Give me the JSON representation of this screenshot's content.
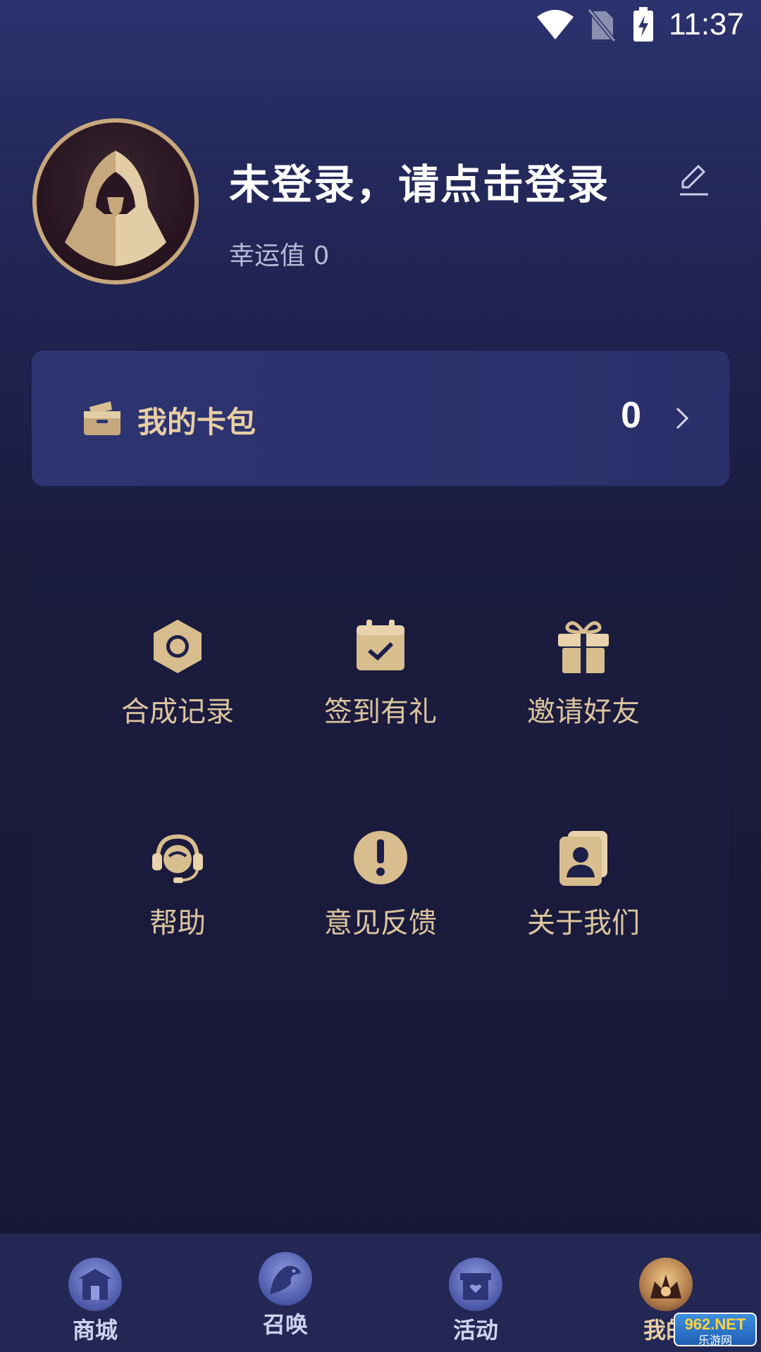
{
  "status_bar": {
    "time": "11:37",
    "icons": [
      "wifi-icon",
      "no-sim-icon",
      "battery-charging-icon"
    ]
  },
  "profile": {
    "title": "未登录，请点击登录",
    "luck_label": "幸运值",
    "luck_value": "0",
    "avatar_icon": "hooded-figure-avatar",
    "edit_icon": "edit-pencil-icon"
  },
  "wallet": {
    "label": "我的卡包",
    "count": "0",
    "icon": "card-wallet-icon",
    "chevron": "chevron-right-icon"
  },
  "menu": {
    "items": [
      {
        "label": "合成记录",
        "icon": "hexagon-target-icon"
      },
      {
        "label": "签到有礼",
        "icon": "calendar-check-icon"
      },
      {
        "label": "邀请好友",
        "icon": "gift-icon"
      },
      {
        "label": "帮助",
        "icon": "headset-icon"
      },
      {
        "label": "意见反馈",
        "icon": "exclamation-icon"
      },
      {
        "label": "关于我们",
        "icon": "contact-card-icon"
      }
    ]
  },
  "bottom_nav": {
    "items": [
      {
        "label": "商城",
        "icon": "shop-icon",
        "active": false
      },
      {
        "label": "召唤",
        "icon": "eagle-icon",
        "active": false
      },
      {
        "label": "活动",
        "icon": "activity-store-icon",
        "active": false
      },
      {
        "label": "我的",
        "icon": "profile-crown-icon",
        "active": true
      }
    ]
  },
  "watermark": {
    "top": "962.NET",
    "bottom": "乐游网"
  },
  "colors": {
    "accent_gold": "#e8cfa3",
    "background": "#1a1a3a",
    "card": "#2e3470"
  }
}
